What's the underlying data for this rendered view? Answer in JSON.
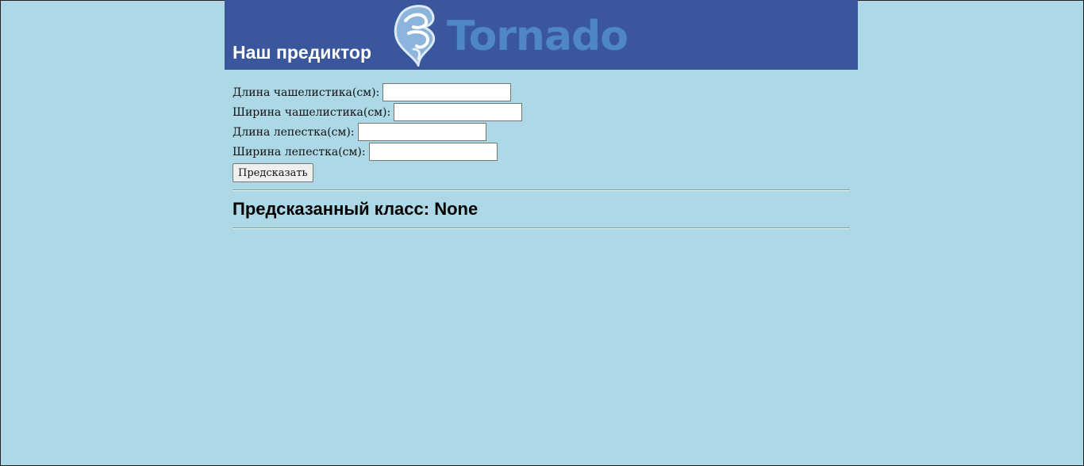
{
  "header": {
    "title": "Наш предиктор",
    "logo_text": "Tornado",
    "background_color": "#3a569c",
    "logo_color": "#4f86c6",
    "logo_icon": "tornado-logo-icon"
  },
  "form": {
    "fields": [
      {
        "label": "Длина чашелистика(см):",
        "value": "",
        "placeholder": ""
      },
      {
        "label": "Ширина чашелистика(см):",
        "value": "",
        "placeholder": ""
      },
      {
        "label": "Длина лепестка(см):",
        "value": "",
        "placeholder": ""
      },
      {
        "label": "Ширина лепестка(см):",
        "value": "",
        "placeholder": ""
      }
    ],
    "submit_label": "Предсказать"
  },
  "result": {
    "text": "Предсказанный класс: None"
  },
  "page": {
    "background_color": "#add8e6"
  }
}
